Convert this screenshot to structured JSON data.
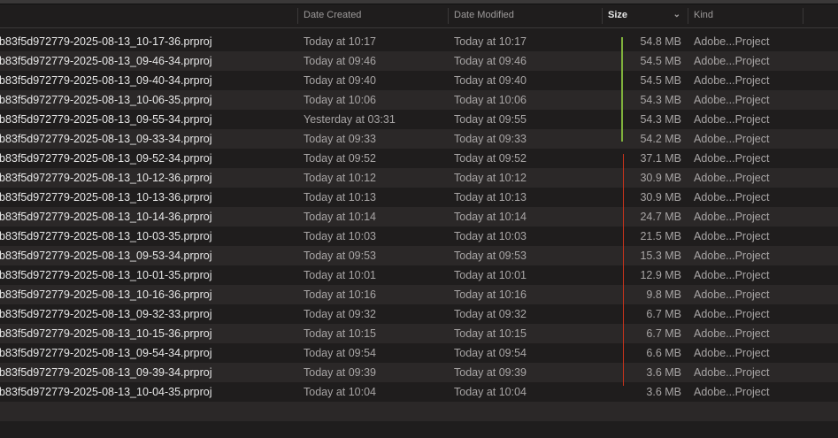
{
  "columns": {
    "name": "",
    "date_created": "Date Created",
    "date_modified": "Date Modified",
    "size": "Size",
    "kind": "Kind"
  },
  "sort_indicator": "chevron-down-icon",
  "colors": {
    "green_bar": "#7fb13c",
    "red_bar": "#c8331c"
  },
  "files": [
    {
      "name": "b83f5d972779-2025-08-13_10-17-36.prproj",
      "created": "Today at 10:17",
      "modified": "Today at 10:17",
      "size": "54.8 MB",
      "kind": "Adobe...Project"
    },
    {
      "name": "b83f5d972779-2025-08-13_09-46-34.prproj",
      "created": "Today at 09:46",
      "modified": "Today at 09:46",
      "size": "54.5 MB",
      "kind": "Adobe...Project"
    },
    {
      "name": "b83f5d972779-2025-08-13_09-40-34.prproj",
      "created": "Today at 09:40",
      "modified": "Today at 09:40",
      "size": "54.5 MB",
      "kind": "Adobe...Project"
    },
    {
      "name": "b83f5d972779-2025-08-13_10-06-35.prproj",
      "created": "Today at 10:06",
      "modified": "Today at 10:06",
      "size": "54.3 MB",
      "kind": "Adobe...Project"
    },
    {
      "name": "b83f5d972779-2025-08-13_09-55-34.prproj",
      "created": "Yesterday at 03:31",
      "modified": "Today at 09:55",
      "size": "54.3 MB",
      "kind": "Adobe...Project"
    },
    {
      "name": "b83f5d972779-2025-08-13_09-33-34.prproj",
      "created": "Today at 09:33",
      "modified": "Today at 09:33",
      "size": "54.2 MB",
      "kind": "Adobe...Project"
    },
    {
      "name": "b83f5d972779-2025-08-13_09-52-34.prproj",
      "created": "Today at 09:52",
      "modified": "Today at 09:52",
      "size": "37.1 MB",
      "kind": "Adobe...Project"
    },
    {
      "name": "b83f5d972779-2025-08-13_10-12-36.prproj",
      "created": "Today at 10:12",
      "modified": "Today at 10:12",
      "size": "30.9 MB",
      "kind": "Adobe...Project"
    },
    {
      "name": "b83f5d972779-2025-08-13_10-13-36.prproj",
      "created": "Today at 10:13",
      "modified": "Today at 10:13",
      "size": "30.9 MB",
      "kind": "Adobe...Project"
    },
    {
      "name": "b83f5d972779-2025-08-13_10-14-36.prproj",
      "created": "Today at 10:14",
      "modified": "Today at 10:14",
      "size": "24.7 MB",
      "kind": "Adobe...Project"
    },
    {
      "name": "b83f5d972779-2025-08-13_10-03-35.prproj",
      "created": "Today at 10:03",
      "modified": "Today at 10:03",
      "size": "21.5 MB",
      "kind": "Adobe...Project"
    },
    {
      "name": "b83f5d972779-2025-08-13_09-53-34.prproj",
      "created": "Today at 09:53",
      "modified": "Today at 09:53",
      "size": "15.3 MB",
      "kind": "Adobe...Project"
    },
    {
      "name": "b83f5d972779-2025-08-13_10-01-35.prproj",
      "created": "Today at 10:01",
      "modified": "Today at 10:01",
      "size": "12.9 MB",
      "kind": "Adobe...Project"
    },
    {
      "name": "b83f5d972779-2025-08-13_10-16-36.prproj",
      "created": "Today at 10:16",
      "modified": "Today at 10:16",
      "size": "9.8 MB",
      "kind": "Adobe...Project"
    },
    {
      "name": "b83f5d972779-2025-08-13_09-32-33.prproj",
      "created": "Today at 09:32",
      "modified": "Today at 09:32",
      "size": "6.7 MB",
      "kind": "Adobe...Project"
    },
    {
      "name": "b83f5d972779-2025-08-13_10-15-36.prproj",
      "created": "Today at 10:15",
      "modified": "Today at 10:15",
      "size": "6.7 MB",
      "kind": "Adobe...Project"
    },
    {
      "name": "b83f5d972779-2025-08-13_09-54-34.prproj",
      "created": "Today at 09:54",
      "modified": "Today at 09:54",
      "size": "6.6 MB",
      "kind": "Adobe...Project"
    },
    {
      "name": "b83f5d972779-2025-08-13_09-39-34.prproj",
      "created": "Today at 09:39",
      "modified": "Today at 09:39",
      "size": "3.6 MB",
      "kind": "Adobe...Project"
    },
    {
      "name": "b83f5d972779-2025-08-13_10-04-35.prproj",
      "created": "Today at 10:04",
      "modified": "Today at 10:04",
      "size": "3.6 MB",
      "kind": "Adobe...Project"
    }
  ]
}
